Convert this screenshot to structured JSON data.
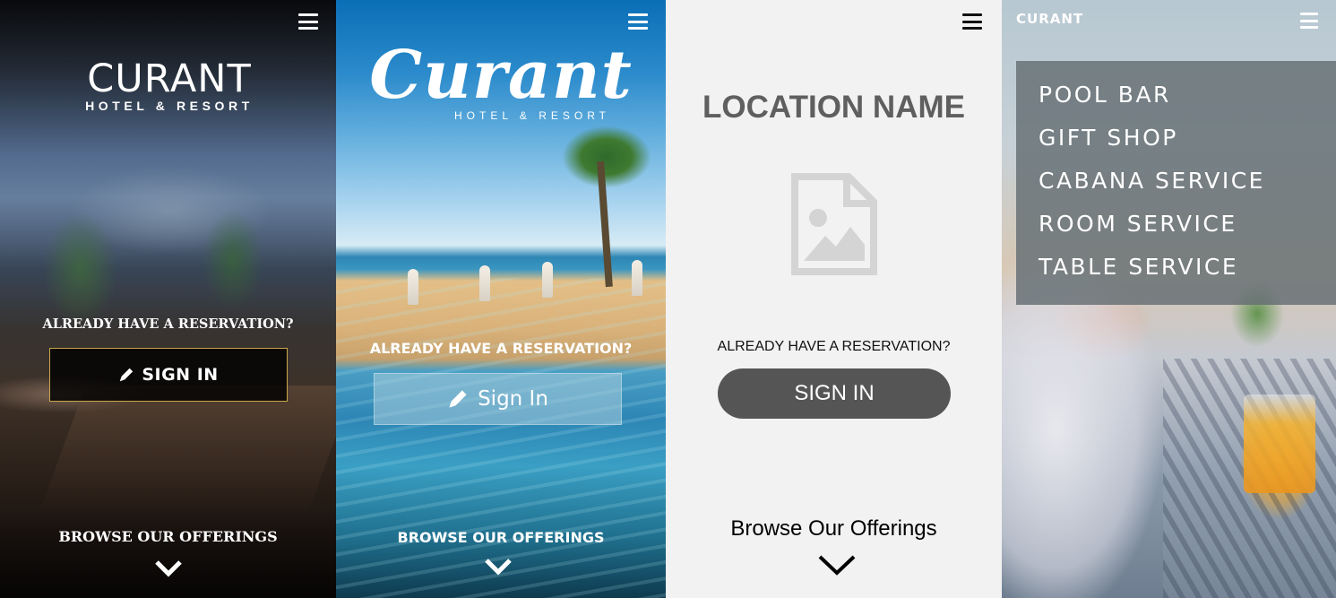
{
  "panel_1": {
    "logo_name": "CURANT",
    "logo_tagline": "HOTEL & RESORT",
    "reservation_prompt": "ALREADY HAVE A RESERVATION?",
    "sign_in_label": "SIGN IN",
    "browse_label": "BROWSE OUR OFFERINGS",
    "colors": {
      "button_border": "#c9a64a",
      "button_bg": "#000000"
    }
  },
  "panel_2": {
    "logo_name": "Curant",
    "logo_tagline": "HOTEL & RESORT",
    "reservation_prompt": "ALREADY HAVE A RESERVATION?",
    "sign_in_label": "Sign In",
    "browse_label": "BROWSE OUR OFFERINGS"
  },
  "panel_3": {
    "location_title": "LOCATION NAME",
    "reservation_prompt": "ALREADY HAVE A RESERVATION?",
    "sign_in_label": "SIGN IN",
    "browse_label": "Browse Our Offerings",
    "colors": {
      "button_bg": "#555555",
      "background": "#f2f2f2"
    }
  },
  "panel_4": {
    "brand": "CURANT",
    "menu_items": [
      "POOL BAR",
      "GIFT SHOP",
      "CABANA SERVICE",
      "ROOM SERVICE",
      "TABLE SERVICE"
    ]
  },
  "icons": {
    "menu": "hamburger-menu-icon",
    "sign_in": "pen-icon",
    "browse": "chevron-down-icon",
    "placeholder": "image-placeholder-icon"
  }
}
